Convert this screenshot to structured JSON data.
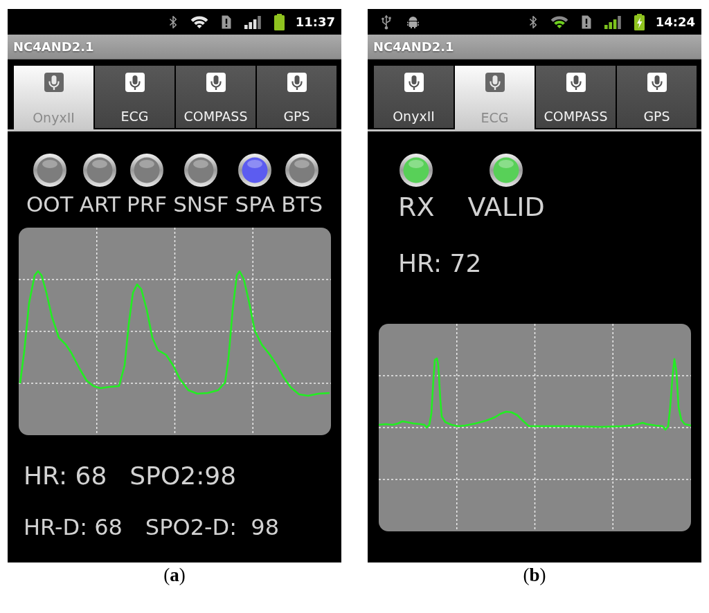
{
  "panels": [
    {
      "status_bar": {
        "online": false,
        "charging": false,
        "time": "11:37"
      },
      "title": "NC4AND2.1",
      "tabs": [
        {
          "label": "OnyxII",
          "selected": true
        },
        {
          "label": "ECG",
          "selected": false
        },
        {
          "label": "COMPASS",
          "selected": false
        },
        {
          "label": "GPS",
          "selected": false
        }
      ],
      "sections": [
        {
          "kind": "indicators",
          "items": [
            {
              "label": "OOT",
              "color": "#7d7d7d"
            },
            {
              "label": "ART",
              "color": "#7d7d7d"
            },
            {
              "label": "PRF",
              "color": "#7d7d7d"
            },
            {
              "label": "SNSF",
              "color": "#7d7d7d"
            },
            {
              "label": "SPA",
              "color": "#5c5cf0"
            },
            {
              "label": "BTS",
              "color": "#7d7d7d"
            }
          ]
        },
        {
          "kind": "pleth_waveform"
        },
        {
          "kind": "readings",
          "rows": [
            [
              "HR: 68",
              "SPO2:98"
            ],
            [
              "HR-D: 68",
              "SPO2-D:  98"
            ]
          ]
        }
      ],
      "caption": "(**a**)"
    },
    {
      "status_bar": {
        "usb": true,
        "debugging": true,
        "online": true,
        "charging": true,
        "time": "14:24"
      },
      "title": "NC4AND2.1",
      "tabs": [
        {
          "label": "OnyxII",
          "selected": false
        },
        {
          "label": "ECG",
          "selected": true
        },
        {
          "label": "COMPASS",
          "selected": false
        },
        {
          "label": "GPS",
          "selected": false
        }
      ],
      "sections": [
        {
          "kind": "indicators",
          "items": [
            {
              "label": "RX",
              "color": "#58d058"
            },
            {
              "label": "VALID",
              "color": "#58d058"
            }
          ]
        },
        {
          "kind": "readings",
          "rows": [
            [
              "HR: 72"
            ]
          ]
        },
        {
          "kind": "ecg_waveform"
        }
      ],
      "caption": "(**b**)"
    }
  ]
}
